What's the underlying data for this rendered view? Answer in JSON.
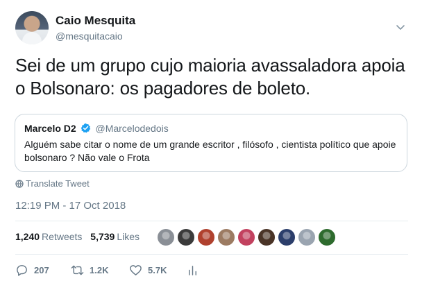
{
  "author": {
    "name": "Caio Mesquita",
    "handle": "@mesquitacaio"
  },
  "tweet": {
    "text": "Sei de um grupo cujo maioria avassaladora apoia o Bolsonaro: os pagadores de boleto."
  },
  "quoted": {
    "name": "Marcelo D2",
    "verified": true,
    "handle": "@Marcelodedois",
    "text": "Alguém sabe citar o nome de um grande escritor , filósofo , cientista político que apoie bolsonaro ? Não vale o Frota"
  },
  "translate_label": "Translate Tweet",
  "timestamp": "12:19 PM - 17 Oct 2018",
  "stats": {
    "retweets_count": "1,240",
    "retweets_label": "Retweets",
    "likes_count": "5,739",
    "likes_label": "Likes"
  },
  "likers": [
    {
      "name": "liker-1",
      "color": "#8a8f96"
    },
    {
      "name": "liker-2",
      "color": "#3b3b3b"
    },
    {
      "name": "liker-3",
      "color": "#b0412e"
    },
    {
      "name": "liker-4",
      "color": "#9c7b62"
    },
    {
      "name": "liker-5",
      "color": "#c2415f"
    },
    {
      "name": "liker-6",
      "color": "#4a3427"
    },
    {
      "name": "liker-7",
      "color": "#2c3e6b"
    },
    {
      "name": "liker-8",
      "color": "#9aa4b0"
    },
    {
      "name": "liker-9",
      "color": "#2e6b2e"
    }
  ],
  "actions": {
    "replies": "207",
    "retweets": "1.2K",
    "likes": "5.7K"
  },
  "colors": {
    "text": "#14171a",
    "secondary": "#657786",
    "border": "#ccd6dd",
    "verified": "#1da1f2"
  }
}
